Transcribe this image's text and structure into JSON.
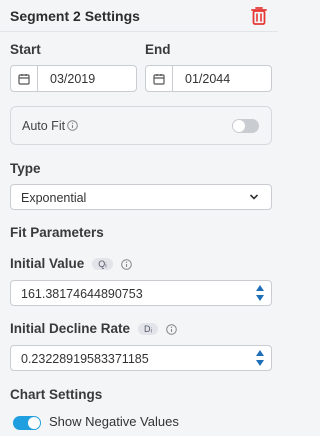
{
  "header": {
    "title": "Segment 2 Settings",
    "delete_icon": "trash-icon",
    "delete_color": "#e53935"
  },
  "start": {
    "label": "Start",
    "value": "03/2019",
    "icon": "calendar-icon"
  },
  "end": {
    "label": "End",
    "value": "01/2044",
    "icon": "calendar-icon"
  },
  "auto_fit": {
    "label": "Auto Fit",
    "enabled": false
  },
  "type": {
    "label": "Type",
    "selected": "Exponential"
  },
  "fit_parameters": {
    "heading": "Fit Parameters",
    "initial_value": {
      "label": "Initial Value",
      "symbol": "Qᵢ",
      "value": "161.38174644890753"
    },
    "initial_decline": {
      "label": "Initial Decline Rate",
      "symbol": "Dᵢ",
      "value": "0.23228919583371185"
    }
  },
  "chart_settings": {
    "heading": "Chart Settings",
    "show_negative": {
      "label": "Show Negative Values",
      "enabled": true
    }
  },
  "colors": {
    "accent": "#1f9fe0",
    "danger": "#e53935"
  }
}
